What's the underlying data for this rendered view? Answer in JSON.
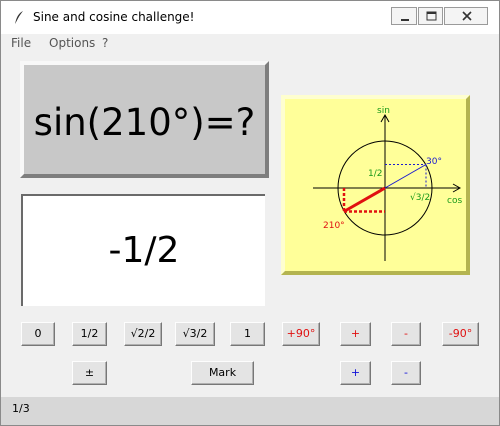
{
  "window": {
    "title": "Sine and cosine challenge!"
  },
  "menu": [
    "File",
    "Options",
    "?"
  ],
  "question": {
    "text": "sin(210°)=?"
  },
  "answer": {
    "text": "-1/2"
  },
  "diagram": {
    "labels": {
      "sin": "sin",
      "cos": "cos",
      "half": "1/2",
      "sqrt3_2": "√3/2",
      "ref_angle": "30°",
      "angle": "210°"
    },
    "colors": {
      "background": "#ffff99",
      "reference": "#1a1ad0",
      "answer": "#e01010",
      "label_green": "#1a9a1a"
    }
  },
  "buttons": {
    "row1": [
      "0",
      "1/2",
      "√2/2",
      "√3/2",
      "1",
      "+90°",
      "+",
      "-",
      "-90°"
    ],
    "row2": [
      "±",
      "Mark",
      "+",
      "-"
    ]
  },
  "status": {
    "text": "1/3"
  }
}
